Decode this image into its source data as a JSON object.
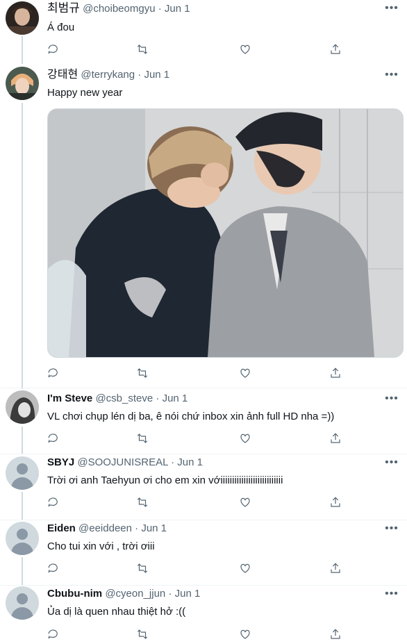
{
  "tweets": [
    {
      "name": "최범규",
      "handle": "@choibeomgyu",
      "date": "Jun 1",
      "text": "Á đou",
      "avatar": "photo-dark"
    },
    {
      "name": "강태현",
      "handle": "@terrykang",
      "date": "Jun 1",
      "text": "Happy new year",
      "avatar": "photo-light",
      "media": "photo-two-people-embrace"
    },
    {
      "name": "I'm Steve",
      "handle": "@csb_steve",
      "date": "Jun 1",
      "text": "VL chơi chụp lén dị ba, ê nói chứ inbox xin ảnh full HD nha =))",
      "avatar": "photo-bw"
    },
    {
      "name": "SBYJ",
      "handle": "@SOOJUNISREAL",
      "date": "Jun 1",
      "text": "Trời ơi anh Taehyun ơi cho em xin vớiiiiiiiiiiiiiiiiiiiiiiiiiii",
      "avatar": "default"
    },
    {
      "name": "Eiden",
      "handle": "@eeiddeen",
      "date": "Jun 1",
      "text": "Cho tui xin với , trời ơiii",
      "avatar": "default"
    },
    {
      "name": "Cbubu-nim",
      "handle": "@cyeon_jjun",
      "date": "Jun 1",
      "text": "Ủa dị là quen nhau thiệt hở :((",
      "avatar": "default"
    }
  ],
  "ui": {
    "separator": " · ",
    "more_glyph": "•••",
    "action_icons": [
      "reply-icon",
      "retweet-icon",
      "like-icon",
      "share-icon"
    ]
  }
}
